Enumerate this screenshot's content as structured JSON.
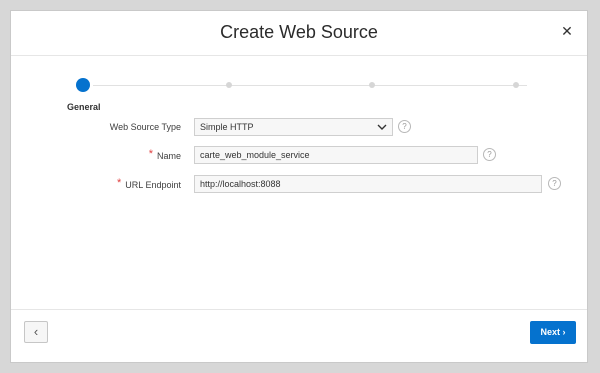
{
  "dialog": {
    "title": "Create Web Source",
    "close_glyph": "✕"
  },
  "wizard": {
    "steps": [
      {
        "label": "General",
        "state": "current"
      },
      {
        "label": "",
        "state": "upcoming"
      },
      {
        "label": "",
        "state": "upcoming"
      },
      {
        "label": "",
        "state": "upcoming"
      }
    ],
    "accent": "#0572ce"
  },
  "form": {
    "web_source_type": {
      "label": "Web Source Type",
      "value": "Simple HTTP",
      "required": false
    },
    "name": {
      "label": "Name",
      "value": "carte_web_module_service",
      "required": true
    },
    "url_endpoint": {
      "label": "URL Endpoint",
      "value": "http://localhost:8088",
      "required": true
    },
    "help_glyph": "?",
    "required_glyph": "*"
  },
  "footer": {
    "previous_glyph": "‹",
    "next_label": "Next ›"
  },
  "colors": {
    "primary": "#0572ce",
    "required": "#e04040"
  }
}
